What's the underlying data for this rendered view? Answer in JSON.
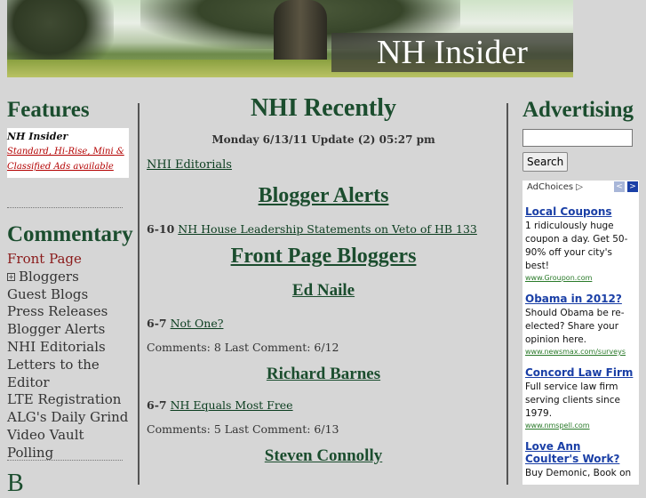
{
  "banner": {
    "title": "NH Insider"
  },
  "left": {
    "features_title": "Features",
    "features_box_title": "NH Insider",
    "features_box_link": "Standard, Hi-Rise, Mini & Classified Ads available",
    "commentary_title": "Commentary",
    "commentary_items": [
      "Front Page",
      "Bloggers",
      "Guest Blogs",
      "Press Releases",
      "Blogger Alerts",
      "NHI Editorials",
      "Letters to the Editor",
      "LTE Registration",
      "ALG's Daily Grind",
      "Video Vault",
      "Polling"
    ],
    "bottom_letter": "B"
  },
  "center": {
    "title": "NHI Recently",
    "update": "Monday 6/13/11 Update (2) 05:27 pm",
    "editorials_link": "NHI Editorials",
    "blogger_alerts_title": "Blogger Alerts",
    "alert_date": "6-10",
    "alert_link": "NH House Leadership Statements on Veto of HB 133",
    "front_page_bloggers_title": "Front Page Bloggers",
    "bloggers": [
      {
        "name": "Ed Naile",
        "date": "6-7",
        "post": "Not One?",
        "comments": "Comments: 8 Last Comment: 6/12"
      },
      {
        "name": "Richard Barnes",
        "date": "6-7",
        "post": "NH Equals Most Free",
        "comments": "Comments: 5 Last Comment: 6/13"
      },
      {
        "name": "Steven Connolly"
      }
    ]
  },
  "right": {
    "advertising_title": "Advertising",
    "search_placeholder": "",
    "search_button": "Search",
    "adchoices": "AdChoices",
    "ads": [
      {
        "title": "Local Coupons",
        "text": "1 ridiculously huge coupon a day. Get 50-90% off your city's best!",
        "url": "www.Groupon.com"
      },
      {
        "title": "Obama in 2012?",
        "text": "Should Obama be re-elected? Share your opinion here.",
        "url": "www.newsmax.com/surveys"
      },
      {
        "title": "Concord Law Firm",
        "text": "Full service law firm serving clients since 1979.",
        "url": "www.nmspell.com"
      },
      {
        "title": "Love Ann Coulter's Work?",
        "text": "Buy Demonic, Book on",
        "url": ""
      }
    ]
  },
  "colors": {
    "heading_green": "#1b4d2e",
    "ad_link_blue": "#1a3fa6",
    "active_red": "#8a1a1a"
  }
}
